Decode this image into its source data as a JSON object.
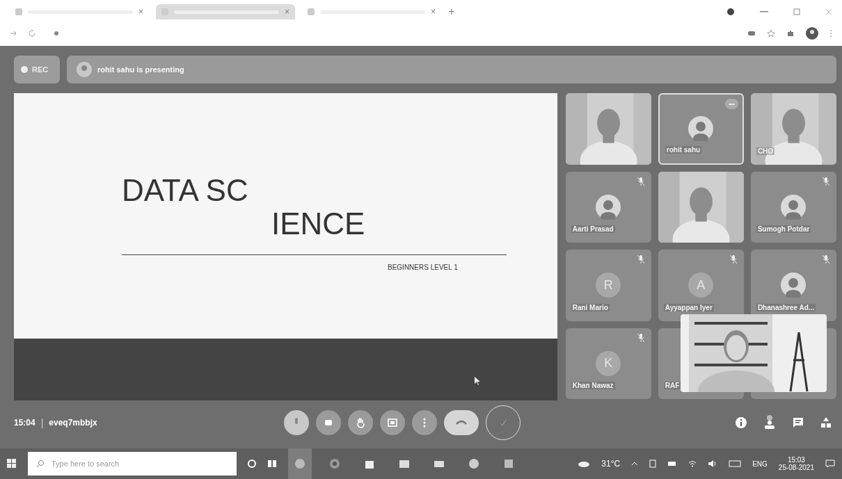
{
  "browser": {
    "tabs": [
      {
        "close": "×",
        "selected": false
      },
      {
        "close": "×",
        "selected": true
      },
      {
        "close": "×",
        "selected": false
      }
    ],
    "new_tab": "+"
  },
  "top_bar": {
    "rec": "REC",
    "presenting": "rohit sahu is presenting"
  },
  "slide": {
    "title_line_1": "DATA SC",
    "title_line_2": "IENCE",
    "subtitle": "BEGINNERS LEVEL 1"
  },
  "tiles": [
    {
      "kind": "video",
      "muted": false
    },
    {
      "kind": "avatar",
      "name": "rohit sahu",
      "muted": false,
      "more": "•••",
      "highlighted": true
    },
    {
      "kind": "video",
      "name": "CHO",
      "muted": false
    },
    {
      "kind": "avatar",
      "name": "Aarti Prasad",
      "muted": true
    },
    {
      "kind": "video",
      "muted": false
    },
    {
      "kind": "avatar",
      "name": "Sumogh Potdar",
      "muted": true
    },
    {
      "kind": "letter",
      "letter": "R",
      "name": "Rani Mario",
      "muted": true
    },
    {
      "kind": "letter",
      "letter": "A",
      "name": "Ayyappan Iyer",
      "muted": true
    },
    {
      "kind": "avatar",
      "name": "Dhanashree Ad...",
      "muted": true
    },
    {
      "kind": "letter",
      "letter": "K",
      "name": "Khan Nawaz",
      "muted": true
    },
    {
      "kind": "empty",
      "name": "RAF",
      "muted": false
    },
    {
      "kind": "empty",
      "muted": false
    }
  ],
  "bottom_bar": {
    "time": "15:04",
    "separator": "|",
    "meeting_code": "eveq7mbbjx"
  },
  "taskbar": {
    "search_placeholder": "Type here to search",
    "weather": "31°C",
    "language": "ENG",
    "clock_time": "15:03",
    "clock_date": "25-08-2021"
  }
}
